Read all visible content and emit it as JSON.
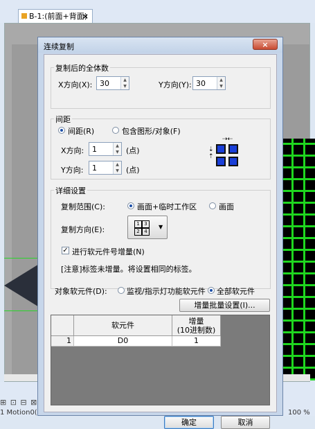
{
  "background": {
    "tab_label": "B-1:(前面+背面)",
    "tab_close": "×",
    "status_text": "1 Motion0(14.5 P1)",
    "status_right": "100 %",
    "bottom_icons": "⊞ ⊡ ⊟ ⊠"
  },
  "dialog": {
    "title": "连续复制",
    "close_label": "×",
    "total": {
      "legend": "复制后的全体数",
      "x_label": "X方向(X):",
      "x_value": "30",
      "y_label": "Y方向(Y):",
      "y_value": "30"
    },
    "spacing": {
      "legend": "间距",
      "radio_spacing": "间距(R)",
      "radio_include": "包含图形/对象(F)",
      "x_label": "X方向:",
      "x_value": "1",
      "x_unit": "(点)",
      "y_label": "Y方向:",
      "y_value": "1",
      "y_unit": "(点)"
    },
    "detail": {
      "legend": "详细设置",
      "range_label": "复制范围(C):",
      "range_option_1": "画面+临时工作区",
      "range_option_2": "画面",
      "direction_label": "复制方向(E):",
      "direction_glyph": "1 3 / 2 4",
      "increment_label": "进行软元件号增量(N)",
      "increment_checked": true,
      "note": "[注意]标签未增量。将设置相同的标签。"
    },
    "target": {
      "label": "对象软元件(D):",
      "option_1": "监视/指示灯功能软元件",
      "option_2": "全部软元件",
      "batch_button": "增量批量设置(I)..."
    },
    "table": {
      "headers": [
        "软元件",
        "增量",
        "(10进制数)"
      ],
      "rows": [
        {
          "index": "1",
          "device": "D0",
          "increment": "1"
        }
      ]
    },
    "ok_label": "确定",
    "cancel_label": "取消"
  }
}
